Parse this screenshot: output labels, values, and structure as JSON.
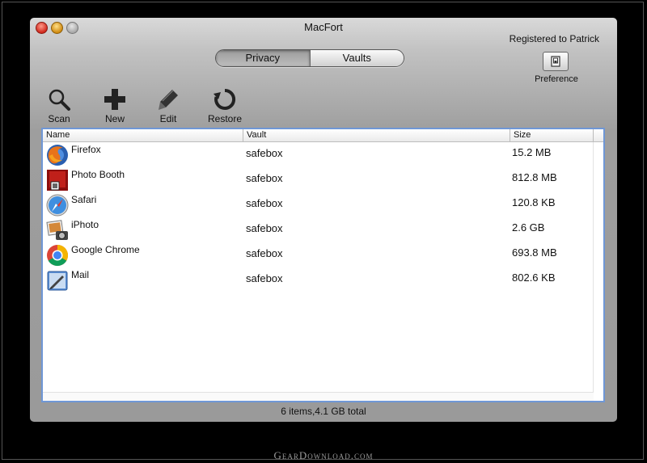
{
  "window": {
    "title": "MacFort"
  },
  "header": {
    "registered_text": "Registered to Patrick",
    "preference_label": "Preference"
  },
  "tabs": [
    {
      "label": "Privacy",
      "active": true
    },
    {
      "label": "Vaults",
      "active": false
    }
  ],
  "toolbar": [
    {
      "label": "Scan",
      "icon": "magnifier-icon"
    },
    {
      "label": "New",
      "icon": "plus-icon"
    },
    {
      "label": "Edit",
      "icon": "pencil-icon"
    },
    {
      "label": "Restore",
      "icon": "restore-icon"
    }
  ],
  "table": {
    "columns": [
      "Name",
      "Vault",
      "Size"
    ],
    "rows": [
      {
        "name": "Firefox",
        "vault": "safebox",
        "size": "15.2 MB",
        "icon": "firefox-icon"
      },
      {
        "name": "Photo Booth",
        "vault": "safebox",
        "size": "812.8 MB",
        "icon": "photo-booth-icon"
      },
      {
        "name": "Safari",
        "vault": "safebox",
        "size": "120.8 KB",
        "icon": "safari-icon"
      },
      {
        "name": "iPhoto",
        "vault": "safebox",
        "size": "2.6 GB",
        "icon": "iphoto-icon"
      },
      {
        "name": "Google Chrome",
        "vault": "safebox",
        "size": "693.8 MB",
        "icon": "chrome-icon"
      },
      {
        "name": "Mail",
        "vault": "safebox",
        "size": "802.6 KB",
        "icon": "mail-icon"
      }
    ]
  },
  "status": {
    "text": "6 items,4.1 GB total"
  },
  "watermark": {
    "text": "GearDownload.com"
  },
  "colors": {
    "selection_border": "#6f97d6",
    "window_bg": "#a6a6a6"
  }
}
